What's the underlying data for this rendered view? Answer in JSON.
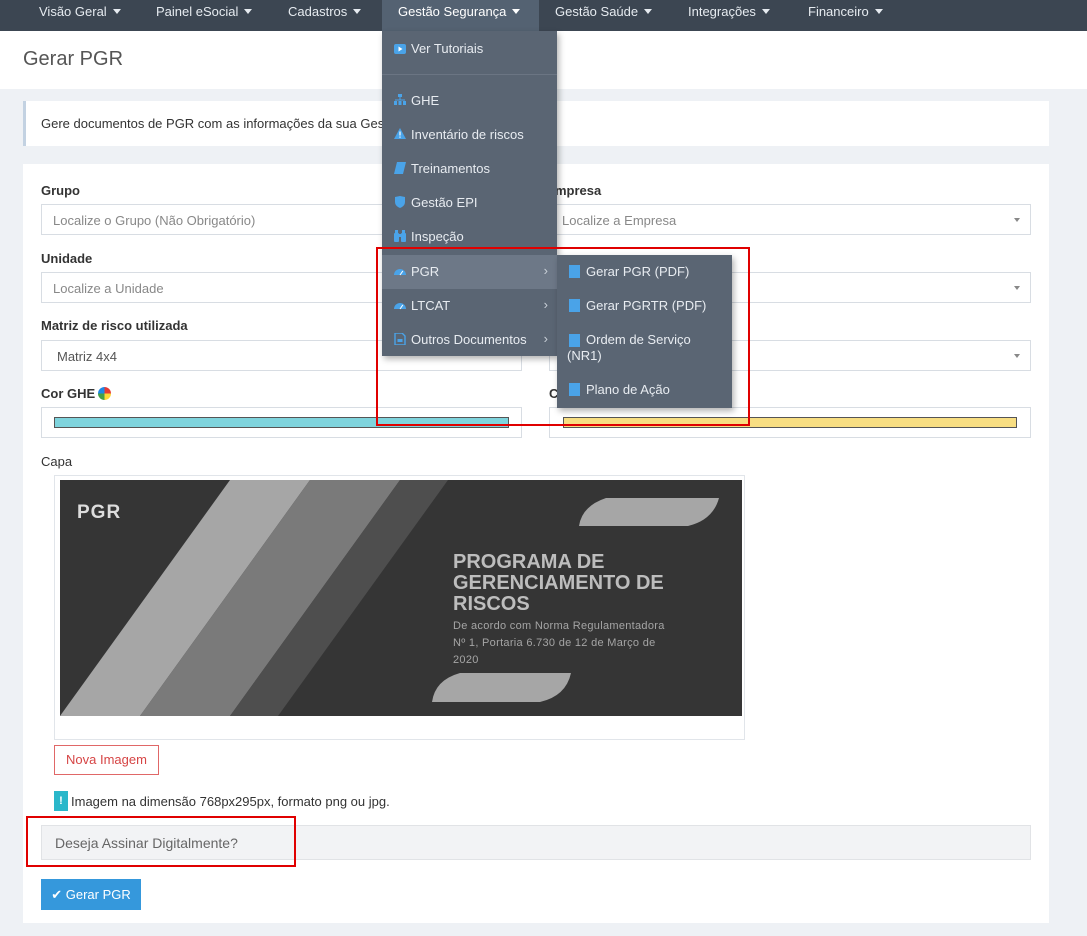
{
  "nav": {
    "items": [
      {
        "label": "Visão Geral"
      },
      {
        "label": "Painel eSocial"
      },
      {
        "label": "Cadastros"
      },
      {
        "label": "Gestão Segurança"
      },
      {
        "label": "Gestão Saúde"
      },
      {
        "label": "Integrações"
      },
      {
        "label": "Financeiro"
      }
    ]
  },
  "page": {
    "title": "Gerar PGR",
    "info": "Gere documentos de PGR com as informações da sua Gestão d"
  },
  "form": {
    "grupo_label": "Grupo",
    "grupo_placeholder": "Localize o Grupo (Não Obrigatório)",
    "empresa_label": "mpresa",
    "empresa_placeholder": "Localize a Empresa",
    "unidade_label": "Unidade",
    "unidade_placeholder": "Localize a Unidade",
    "matriz_label": "Matriz de risco utilizada",
    "matriz_value": "Matriz 4x4",
    "cor_ghe_label": "Cor GHE",
    "cor_ghe_value": "#7fd4dd",
    "cor_right_label": "C",
    "cor_right_value": "#f8de82",
    "capa_label": "Capa",
    "nova_imagem": "Nova Imagem",
    "hint_icon": "!",
    "hint": "Imagem na dimensão 768px295px, formato png ou jpg.",
    "assinar": "Deseja Assinar Digitalmente?",
    "gerar_button": "Gerar PGR"
  },
  "cover": {
    "logo": "PGR",
    "title_lines": [
      "PROGRAMA DE",
      "GERENCIAMENTO DE",
      "RISCOS"
    ],
    "subtitle_lines": [
      "De acordo com Norma Regulamentadora",
      "Nº 1, Portaria 6.730 de 12 de Março de",
      "2020"
    ]
  },
  "dropdown": {
    "items": [
      {
        "label": "Ver Tutoriais",
        "icon": "youtube-icon"
      },
      {
        "label": "GHE",
        "icon": "sitemap-icon"
      },
      {
        "label": "Inventário de riscos",
        "icon": "warning-icon"
      },
      {
        "label": "Treinamentos",
        "icon": "book-icon"
      },
      {
        "label": "Gestão EPI",
        "icon": "shield-icon"
      },
      {
        "label": "Inspeção",
        "icon": "binoculars-icon"
      },
      {
        "label": "PGR",
        "icon": "dashboard-icon"
      },
      {
        "label": "LTCAT",
        "icon": "dashboard-icon"
      },
      {
        "label": "Outros Documentos",
        "icon": "pdf-file-icon"
      }
    ]
  },
  "submenu": {
    "items": [
      {
        "label": "Gerar PGR (PDF)"
      },
      {
        "label": "Gerar PGRTR (PDF)"
      },
      {
        "label": "Ordem de Serviço",
        "label2": "(NR1)"
      },
      {
        "label": "Plano de Ação"
      }
    ]
  },
  "colors": {
    "nav_bg": "#3c4652",
    "dropdown_bg": "#5a6573",
    "primary": "#3598dc",
    "highlight_red": "#e00000"
  }
}
